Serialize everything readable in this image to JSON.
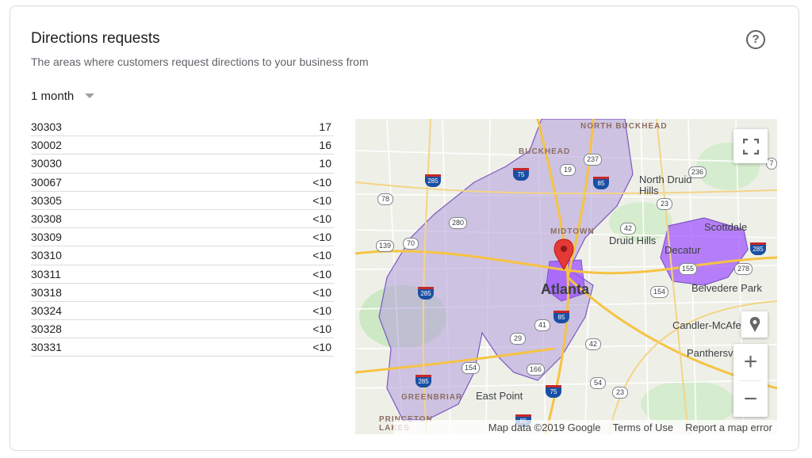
{
  "card": {
    "title": "Directions requests",
    "subtitle": "The areas where customers request directions to your business from",
    "help_icon": "help-circle-icon",
    "range_label": "1 month"
  },
  "rows": [
    {
      "zip": "30303",
      "count": "17"
    },
    {
      "zip": "30002",
      "count": "16"
    },
    {
      "zip": "30030",
      "count": "10"
    },
    {
      "zip": "30067",
      "count": "<10"
    },
    {
      "zip": "30305",
      "count": "<10"
    },
    {
      "zip": "30308",
      "count": "<10"
    },
    {
      "zip": "30309",
      "count": "<10"
    },
    {
      "zip": "30310",
      "count": "<10"
    },
    {
      "zip": "30311",
      "count": "<10"
    },
    {
      "zip": "30318",
      "count": "<10"
    },
    {
      "zip": "30324",
      "count": "<10"
    },
    {
      "zip": "30328",
      "count": "<10"
    },
    {
      "zip": "30331",
      "count": "<10"
    }
  ],
  "map": {
    "labels": {
      "north_buckhead": "NORTH BUCKHEAD",
      "buckhead": "BUCKHEAD",
      "north_druid_hills": "North Druid Hills",
      "midtown": "MIDTOWN",
      "atlanta_district": "ATLANTA",
      "druid_hills": "Druid Hills",
      "scottdale": "Scottdale",
      "decatur": "Decatur",
      "atlanta": "Atlanta",
      "belvedere_park": "Belvedere Park",
      "candler": "Candler-McAfe",
      "panthersv": "Panthersv",
      "greenbriar": "GREENBRIAR",
      "east_point": "East Point",
      "princeton_lakes": "PRINCETON LAKES"
    },
    "shields": {
      "s237": "237",
      "s19": "19",
      "s236": "236",
      "s78": "78",
      "s280": "280",
      "s42a": "42",
      "s139": "139",
      "s70": "70",
      "s155": "155",
      "s278": "278",
      "s154a": "154",
      "s41": "41",
      "s29": "29",
      "s42b": "42",
      "s154b": "154",
      "s166": "166",
      "s54": "54",
      "s23a": "23",
      "s23b": "23",
      "s7": "7"
    },
    "interstates": {
      "i285a": "285",
      "i75": "75",
      "i85a": "85",
      "i285b": "285",
      "i85b": "85",
      "i285c": "285",
      "i75b": "75",
      "i85c": "85",
      "i285d": "285"
    },
    "fullscreen_icon": "fullscreen-icon",
    "pegman_icon": "pegman-icon",
    "zoom_in": "+",
    "zoom_out": "−",
    "attribution": {
      "map_data": "Map data ©2019 Google",
      "terms": "Terms of Use",
      "report": "Report a map error"
    },
    "colors": {
      "region_fill": "#b39ddb",
      "region_strong": "#9c4dff",
      "marker": "#e53935"
    }
  }
}
